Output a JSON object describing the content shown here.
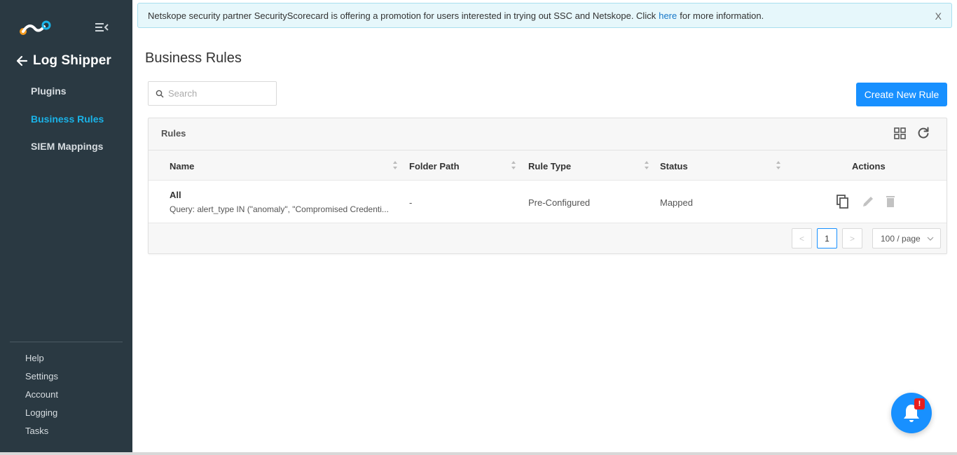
{
  "sidebar": {
    "back_title": "Log Shipper",
    "nav": [
      {
        "label": "Plugins"
      },
      {
        "label": "Business Rules"
      },
      {
        "label": "SIEM Mappings"
      }
    ],
    "bottom": [
      {
        "label": "Help"
      },
      {
        "label": "Settings"
      },
      {
        "label": "Account"
      },
      {
        "label": "Logging"
      },
      {
        "label": "Tasks"
      }
    ],
    "active_color": "#1ab3e8",
    "bg_color": "#2a3942"
  },
  "banner": {
    "text_before": "Netskope security partner SecurityScorecard is offering a promotion for users interested in trying out SSC and Netskope. Click",
    "link": "here",
    "text_after": "for more information.",
    "close": "X"
  },
  "page": {
    "title": "Business Rules",
    "search_placeholder": "Search",
    "create_button": "Create New Rule"
  },
  "card": {
    "title": "Rules",
    "columns": [
      "Name",
      "Folder Path",
      "Rule Type",
      "Status",
      "Actions"
    ],
    "rows": [
      {
        "name": "All",
        "query": "Query: alert_type IN (\"anomaly\", \"Compromised Credenti...",
        "folder_path": "-",
        "rule_type": "Pre-Configured",
        "status": "Mapped"
      }
    ],
    "pagination": {
      "prev": "<",
      "current_page": "1",
      "next": ">",
      "page_size": "100 / page"
    }
  },
  "notification": {
    "badge": "!"
  },
  "colors": {
    "primary": "#1890ff",
    "badge": "#e81e1e"
  }
}
